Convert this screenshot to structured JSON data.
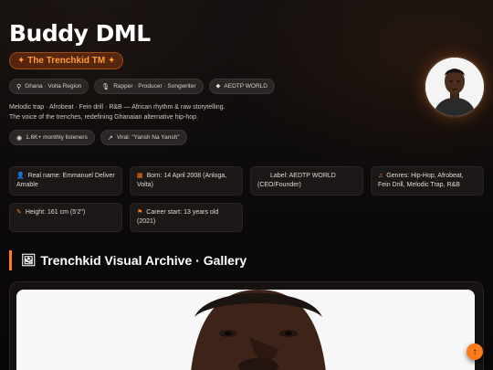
{
  "profile": {
    "name": "Buddy DML",
    "tagline": "✦ The Trenchkid TM ✦",
    "chips": [
      {
        "icon": "map-pin-icon",
        "glyph": "⚲",
        "label": "Ghana · Volta Region"
      },
      {
        "icon": "microphone-icon",
        "glyph": "🎙",
        "label": "Rapper · Producer · Songwriter"
      },
      {
        "icon": "tag-icon",
        "glyph": "⬥",
        "label": "AEDTP WORLD"
      }
    ],
    "bio": "Melodic trap · Afrobeat · Fein drill · R&B — African rhythm & raw storytelling. The voice of the trenches, redefining Ghanaian alternative hip-hop.",
    "stats": [
      {
        "icon": "headphones-icon",
        "glyph": "◉",
        "label": "1.6K+ monthly listeners"
      },
      {
        "icon": "trending-icon",
        "glyph": "↗",
        "label": "Viral: \"Yansh Na Yansh\""
      }
    ]
  },
  "details": [
    {
      "icon": "user-icon",
      "glyph": "👤",
      "text": "Real name: Emmanuel Deliver Amable"
    },
    {
      "icon": "calendar-icon",
      "glyph": "▦",
      "text": "Born: 14 April 2008 (Anloga, Volta)"
    },
    {
      "icon": "building-icon",
      "glyph": "",
      "text": "Label: AEDTP WORLD (CEO/Founder)"
    },
    {
      "icon": "music-note-icon",
      "glyph": "♫",
      "text": "Genres: Hip-Hop, Afrobeat, Fein Drill, Melodic Trap, R&B"
    },
    {
      "icon": "ruler-icon",
      "glyph": "✎",
      "text": "Height: 161 cm (5'2\")"
    },
    {
      "icon": "flag-icon",
      "glyph": "⚑",
      "text": "Career start: 13 years old (2021)"
    }
  ],
  "gallery": {
    "icon_glyph": "🖼",
    "title": "Trenchkid Visual Archive · Gallery"
  },
  "scroll_top": {
    "glyph": "↑"
  },
  "colors": {
    "accent": "#ff7a1a",
    "background": "#0a0808",
    "card": "#1c1818"
  }
}
